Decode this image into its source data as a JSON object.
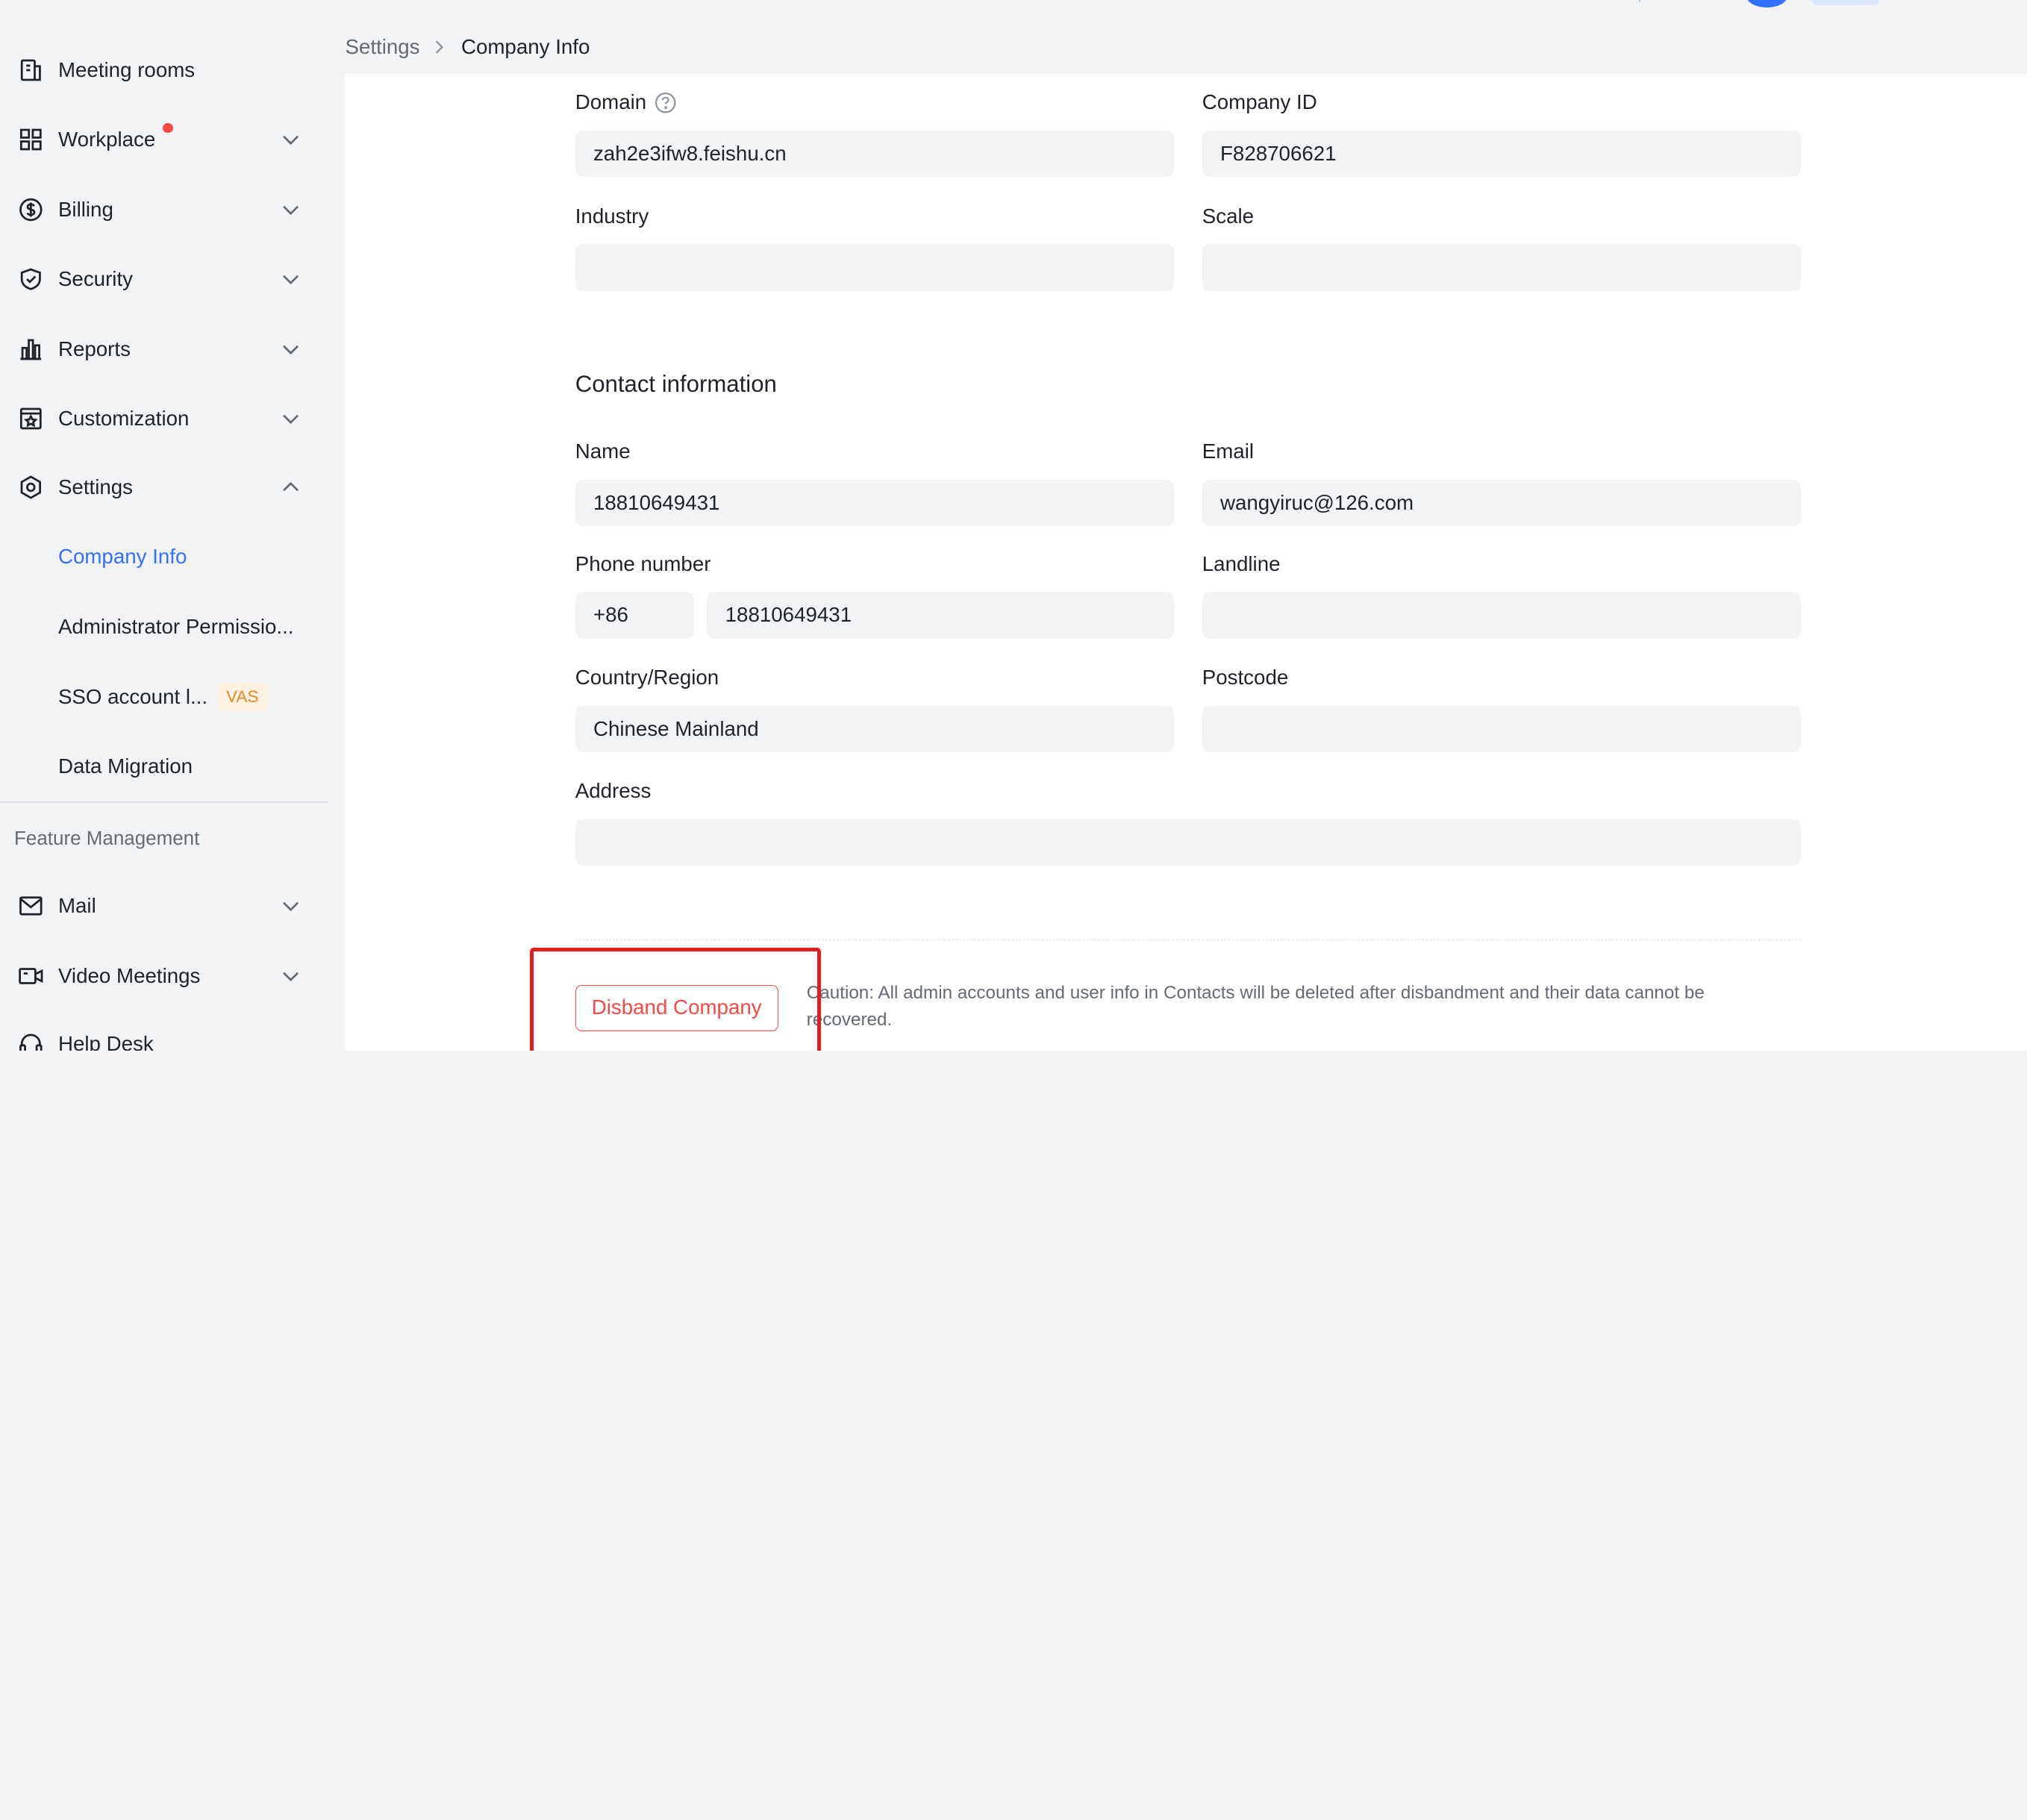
{
  "sidebar": {
    "items": [
      {
        "label": "Meeting rooms",
        "icon": "building-icon"
      },
      {
        "label": "Workplace",
        "icon": "grid-icon"
      },
      {
        "label": "Billing",
        "icon": "dollar-icon"
      },
      {
        "label": "Security",
        "icon": "shield-icon"
      },
      {
        "label": "Reports",
        "icon": "bar-chart-icon"
      },
      {
        "label": "Customization",
        "icon": "customize-icon"
      },
      {
        "label": "Settings",
        "icon": "settings-icon"
      }
    ],
    "settings_sub": [
      {
        "label": "Company Info",
        "active": true
      },
      {
        "label": "Administrator Permissio..."
      },
      {
        "label": "SSO account l...",
        "badge": "VAS"
      },
      {
        "label": "Data Migration"
      }
    ],
    "feature_section_title": "Feature Management",
    "feature_items": [
      {
        "label": "Mail",
        "icon": "mail-icon"
      },
      {
        "label": "Video Meetings",
        "icon": "video-icon"
      },
      {
        "label": "Help Desk",
        "icon": "headset-icon"
      }
    ]
  },
  "breadcrumb": {
    "parent": "Settings",
    "current": "Company Info"
  },
  "company": {
    "domain_label": "Domain",
    "domain_value": "zah2e3ifw8.feishu.cn",
    "company_id_label": "Company ID",
    "company_id_value": "F828706621",
    "industry_label": "Industry",
    "industry_value": "",
    "scale_label": "Scale",
    "scale_value": ""
  },
  "contact": {
    "title": "Contact information",
    "name_label": "Name",
    "name_value": "18810649431",
    "email_label": "Email",
    "email_value": "wangyiruc@126.com",
    "phone_label": "Phone number",
    "phone_code": "+86",
    "phone_value": "18810649431",
    "landline_label": "Landline",
    "landline_value": "",
    "country_label": "Country/Region",
    "country_value": "Chinese Mainland",
    "postcode_label": "Postcode",
    "postcode_value": "",
    "address_label": "Address",
    "address_value": ""
  },
  "danger": {
    "disband_label": "Disband Company",
    "caution_text": "Caution: All admin accounts and user info in Contacts will be deleted after disbandment and their data cannot be recovered."
  },
  "colors": {
    "accent": "#3370ff",
    "danger": "#f54a45",
    "highlight": "#e0201f",
    "vas": "#e08e2a"
  }
}
